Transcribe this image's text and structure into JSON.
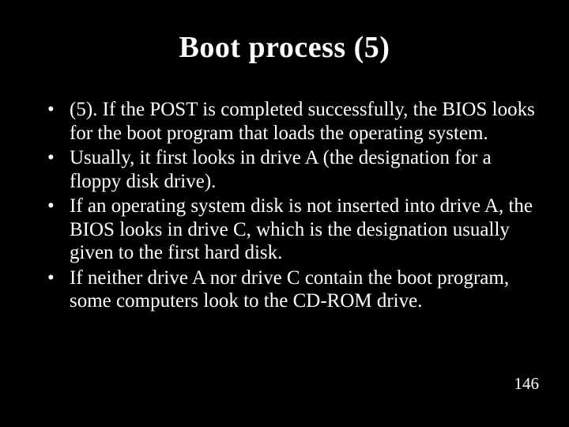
{
  "slide": {
    "title": "Boot process (5)",
    "bullets": [
      "(5). If the POST is completed successfully, the BIOS looks for the boot program that loads the operating system.",
      "Usually, it first looks in drive A (the designation for a floppy disk drive).",
      "If an operating system disk is not inserted into drive A, the BIOS looks in drive C, which is the designation usually given to the first hard disk.",
      "If neither drive A nor drive C contain the boot program, some computers look to the CD-ROM drive."
    ],
    "page_number": "146",
    "bullet_marker": "•"
  }
}
